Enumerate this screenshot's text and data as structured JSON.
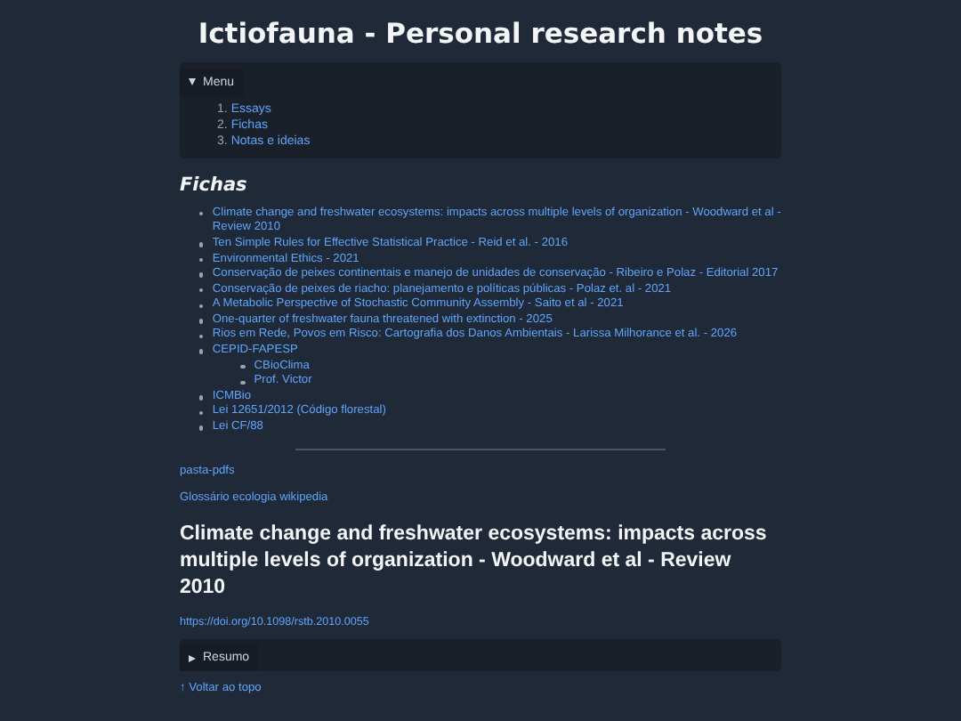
{
  "title": "Ictiofauna - Personal research notes",
  "menu": {
    "label": "Menu",
    "expanded": true,
    "items": [
      {
        "number": "1.",
        "label": "Essays"
      },
      {
        "number": "2.",
        "label": "Fichas"
      },
      {
        "number": "3.",
        "label": "Notas e ideias"
      }
    ]
  },
  "section_heading": "Fichas",
  "fichas": [
    {
      "label": "Climate change and freshwater ecosystems: impacts across multiple levels of organization - Woodward et al - Review 2010"
    },
    {
      "label": "Ten Simple Rules for Effective Statistical Practice - Reid et al. - 2016"
    },
    {
      "label": "Environmental Ethics - 2021"
    },
    {
      "label": "Conservação de peixes continentais e manejo de unidades de conservação - Ribeiro e Polaz - Editorial 2017"
    },
    {
      "label": "Conservação de peixes de riacho: planejamento e políticas públicas - Polaz et. al - 2021"
    },
    {
      "label": "A Metabolic Perspective of Stochastic Community Assembly - Saito et al - 2021"
    },
    {
      "label": "One-quarter of freshwater fauna threatened with extinction - 2025"
    },
    {
      "label": "Rios em Rede, Povos em Risco: Cartografia dos Danos Ambientais - Larissa Milhorance et al. - 2026"
    },
    {
      "label": "CEPID-FAPESP",
      "children": [
        {
          "label": "CBioClima"
        },
        {
          "label": "Prof. Victor"
        }
      ]
    },
    {
      "label": "ICMBio"
    },
    {
      "label": "Lei 12651/2012 (Código florestal)"
    },
    {
      "label": "Lei CF/88"
    }
  ],
  "links": [
    "pasta-pdfs",
    "Glossário ecologia wikipedia"
  ],
  "article": {
    "title": "Climate change and freshwater ecosystems: impacts across multiple levels of organization - Woodward et al - Review 2010",
    "doi": "https://doi.org/10.1098/rstb.2010.0055",
    "summary": {
      "label": "Resumo",
      "expanded": false
    }
  },
  "back_link": "↑ Voltar ao topo"
}
